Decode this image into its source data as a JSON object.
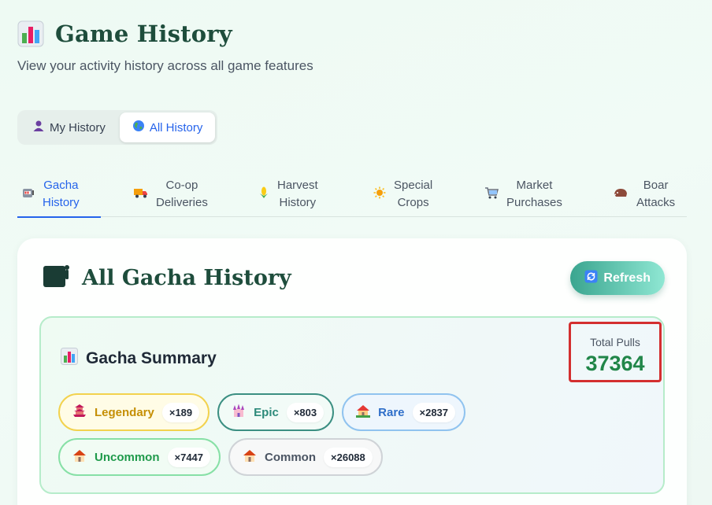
{
  "header": {
    "title": "Game History",
    "subtitle": "View your activity history across all game features",
    "icon": "bar-chart-icon"
  },
  "scope_toggle": [
    {
      "label": "My History",
      "icon": "person-icon",
      "active": false
    },
    {
      "label": "All History",
      "icon": "globe-icon",
      "active": true
    }
  ],
  "tabs": [
    {
      "label": "Gacha\nHistory",
      "icon": "slot-machine-icon",
      "active": true
    },
    {
      "label": "Co-op\nDeliveries",
      "icon": "truck-icon",
      "active": false
    },
    {
      "label": "Harvest\nHistory",
      "icon": "corn-icon",
      "active": false
    },
    {
      "label": "Special\nCrops",
      "icon": "sun-icon",
      "active": false
    },
    {
      "label": "Market\nPurchases",
      "icon": "cart-icon",
      "active": false
    },
    {
      "label": "Boar\nAttacks",
      "icon": "boar-icon",
      "active": false
    }
  ],
  "card": {
    "title": "All Gacha History",
    "title_icon": "slot-machine-icon",
    "refresh_label": "Refresh",
    "refresh_icon": "refresh-icon"
  },
  "summary": {
    "title": "Gacha Summary",
    "icon": "bar-chart-icon",
    "total_label": "Total Pulls",
    "total_value": "37364",
    "rarities": [
      {
        "label": "Legendary",
        "count": "×189",
        "icon": "pagoda-icon",
        "color": "#c58f05"
      },
      {
        "label": "Epic",
        "count": "×803",
        "icon": "castle-icon",
        "color": "#2d8a7a"
      },
      {
        "label": "Rare",
        "count": "×2837",
        "icon": "house-garden-icon",
        "color": "#2f6fc9"
      },
      {
        "label": "Uncommon",
        "count": "×7447",
        "icon": "house-icon",
        "color": "#1f9a4b"
      },
      {
        "label": "Common",
        "count": "×26088",
        "icon": "house-icon",
        "color": "#4b5563"
      }
    ]
  },
  "colors": {
    "accent": "#2563eb",
    "heading": "#1e4d3c",
    "highlight_border": "#d32f2f",
    "total_value": "#218649"
  }
}
